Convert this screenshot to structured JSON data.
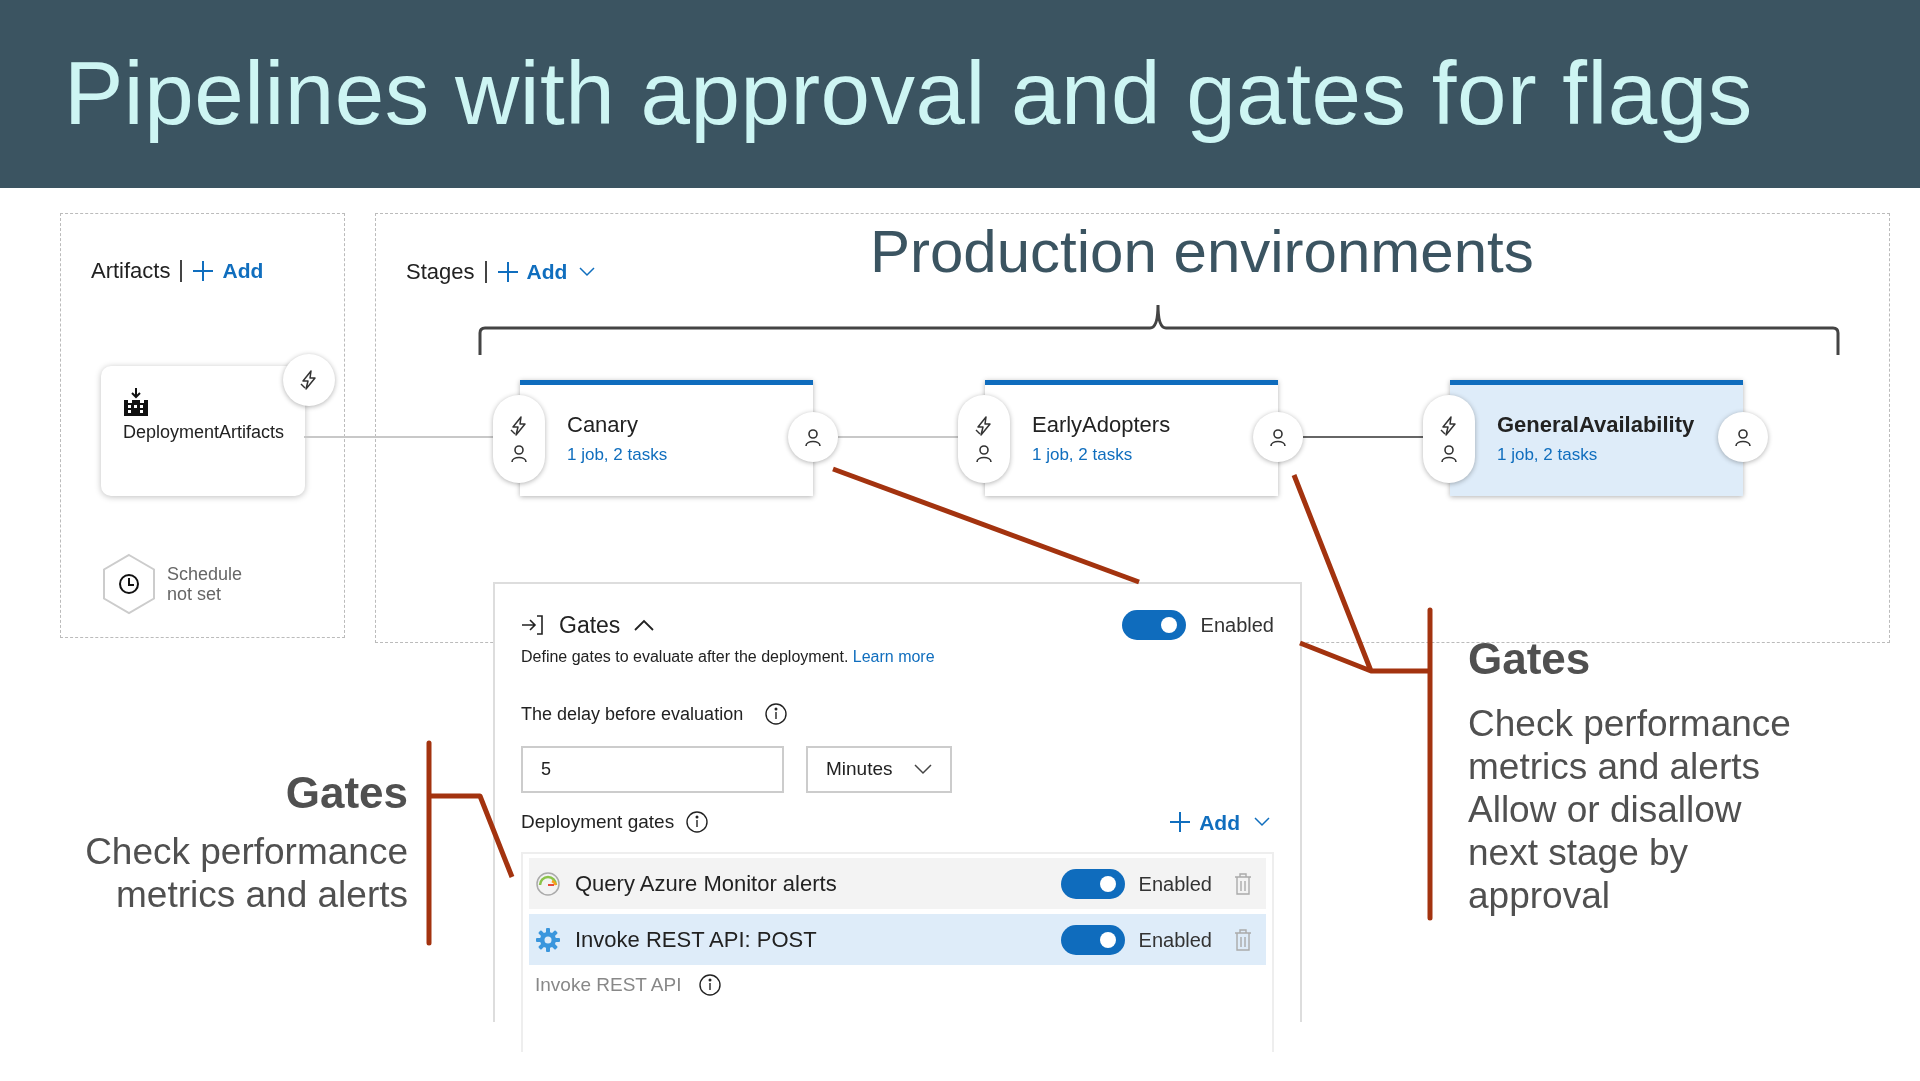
{
  "slide": {
    "title": "Pipelines with approval and gates for flags",
    "callout": "Production environments"
  },
  "artifacts": {
    "heading": "Artifacts",
    "add": "Add",
    "artifact": "DeploymentArtifacts",
    "schedule": "Schedule not set"
  },
  "stages": {
    "heading": "Stages",
    "add": "Add",
    "items": [
      {
        "name": "Canary",
        "summary": "1 job, 2 tasks",
        "selected": false
      },
      {
        "name": "EarlyAdopters",
        "summary": "1 job, 2 tasks",
        "selected": false
      },
      {
        "name": "GeneralAvailability",
        "summary": "1 job, 2 tasks",
        "selected": true
      }
    ]
  },
  "gates_panel": {
    "title": "Gates",
    "on": true,
    "status": "Enabled",
    "description": "Define gates to evaluate after the deployment.",
    "learn_more": "Learn more",
    "delay_label": "The delay before evaluation",
    "delay_value": "5",
    "delay_unit": "Minutes",
    "gates_label": "Deployment gates",
    "add": "Add",
    "gates": [
      {
        "kind": "monitor",
        "name": "Query Azure Monitor alerts",
        "on": true,
        "status": "Enabled",
        "selected": false
      },
      {
        "kind": "rest",
        "name": "Invoke REST API: POST",
        "on": true,
        "status": "Enabled",
        "selected": true
      }
    ],
    "detail_label": "Invoke REST API"
  },
  "annotations": [
    {
      "heading": "Gates",
      "body": [
        "Check performance metrics and alerts"
      ]
    },
    {
      "heading": "Gates",
      "body": [
        "Check performance metrics and alerts",
        "Allow or disallow next stage by approval"
      ]
    }
  ]
}
